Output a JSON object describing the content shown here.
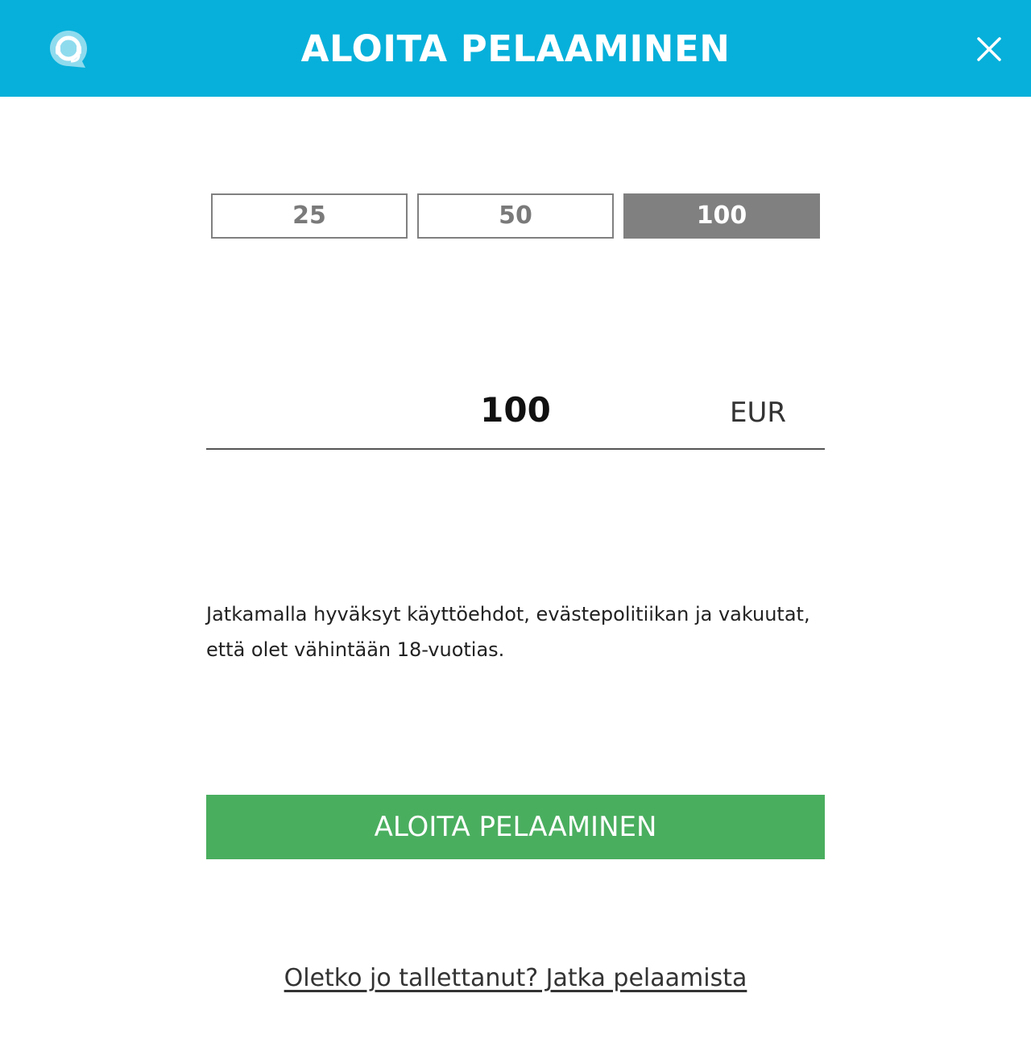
{
  "header": {
    "title": "ALOITA PELAAMINEN",
    "support_icon": "headset-chat-icon",
    "close_icon": "close-icon"
  },
  "amounts": {
    "options": [
      "25",
      "50",
      "100"
    ],
    "selected": "100"
  },
  "amount_field": {
    "value": "100",
    "currency": "EUR"
  },
  "terms": {
    "line1": "Jatkamalla hyväksyt käyttöehdot, evästepolitiikan ja vakuutat,",
    "line2": "että olet vähintään 18-vuotias."
  },
  "cta": {
    "label": "ALOITA PELAAMINEN"
  },
  "continue_link": {
    "label": "Oletko jo tallettanut? Jatka pelaamista"
  },
  "colors": {
    "header": "#07b0da",
    "cta": "#4aae5f",
    "selected_amount": "#808080"
  }
}
